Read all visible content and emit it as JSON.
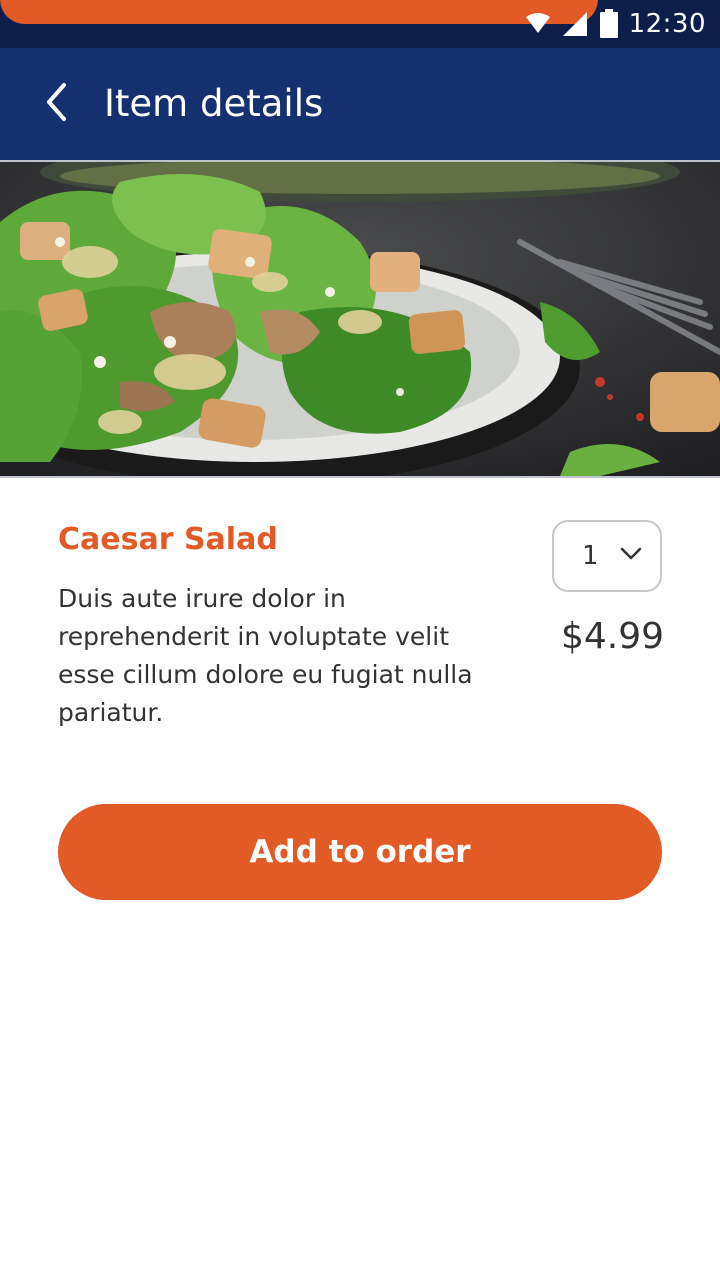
{
  "status_bar": {
    "time": "12:30",
    "icons": [
      "wifi-icon",
      "cell-signal-icon",
      "battery-icon"
    ]
  },
  "app_bar": {
    "title": "Item details",
    "back_icon": "chevron-left-icon"
  },
  "item": {
    "name": "Caesar Salad",
    "description": "Duis aute irure dolor in reprehenderit in voluptate velit esse cillum dolore eu fugiat nulla pariatur.",
    "price": "$4.99",
    "quantity": "1"
  },
  "actions": {
    "add_label": "Add to order"
  },
  "colors": {
    "accent": "#e25a26",
    "app_bar": "#14306f",
    "status_bar": "#0d1e4a"
  }
}
